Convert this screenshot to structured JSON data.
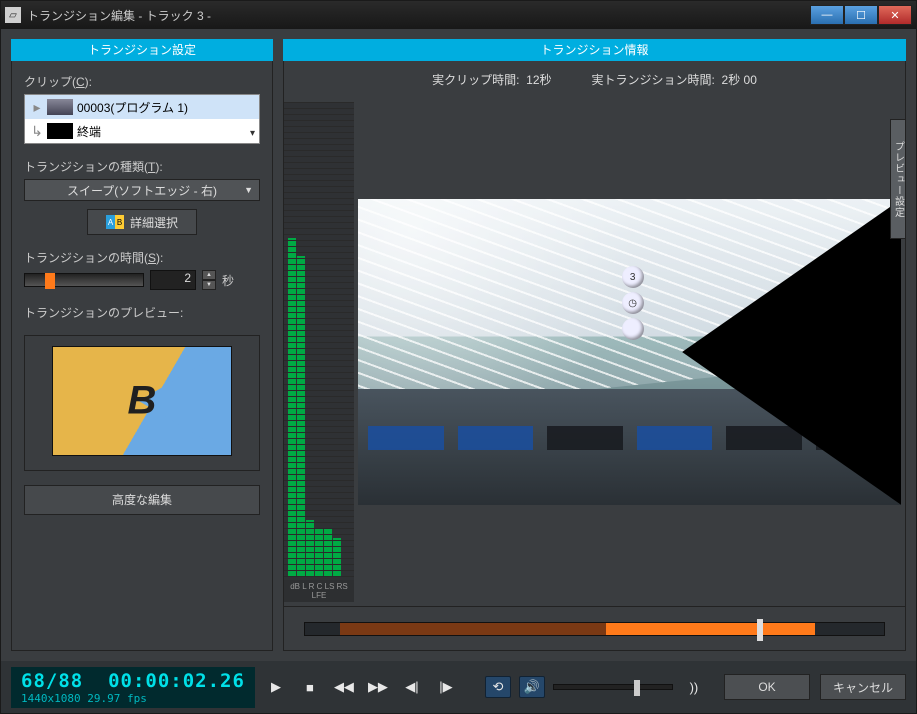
{
  "window": {
    "title": "トランジション編集 - トラック 3 -"
  },
  "left": {
    "header": "トランジション設定",
    "clip_label_prefix": "クリップ(",
    "clip_label_key": "C",
    "clip_label_suffix": "):",
    "clip_selected": "00003(プログラム 1)",
    "clip_end": "終端",
    "type_label_prefix": "トランジションの種類(",
    "type_label_key": "T",
    "type_label_suffix": "):",
    "type_value": "スイープ(ソフトエッジ - 右)",
    "detail_button": "詳細選択",
    "time_label_prefix": "トランジションの時間(",
    "time_label_key": "S",
    "time_label_suffix": "):",
    "time_value": "2",
    "time_unit": "秒",
    "preview_label": "トランジションのプレビュー:",
    "preview_letter": "B",
    "advanced_button": "高度な編集"
  },
  "right": {
    "header": "トランジション情報",
    "real_clip_label": "実クリップ時間:",
    "real_clip_value": "12秒",
    "real_trans_label": "実トランジション時間:",
    "real_trans_value": "2秒 00",
    "clock_top": "3",
    "side_tab": "プレビュー設定",
    "meter_labels": "dB  L  R  C  LS RS LFE"
  },
  "transport": {
    "frame_counter": "68/88",
    "timecode": "00:00:02.26",
    "resolution_fps": "1440x1080 29.97 fps",
    "ok": "OK",
    "cancel": "キャンセル"
  }
}
